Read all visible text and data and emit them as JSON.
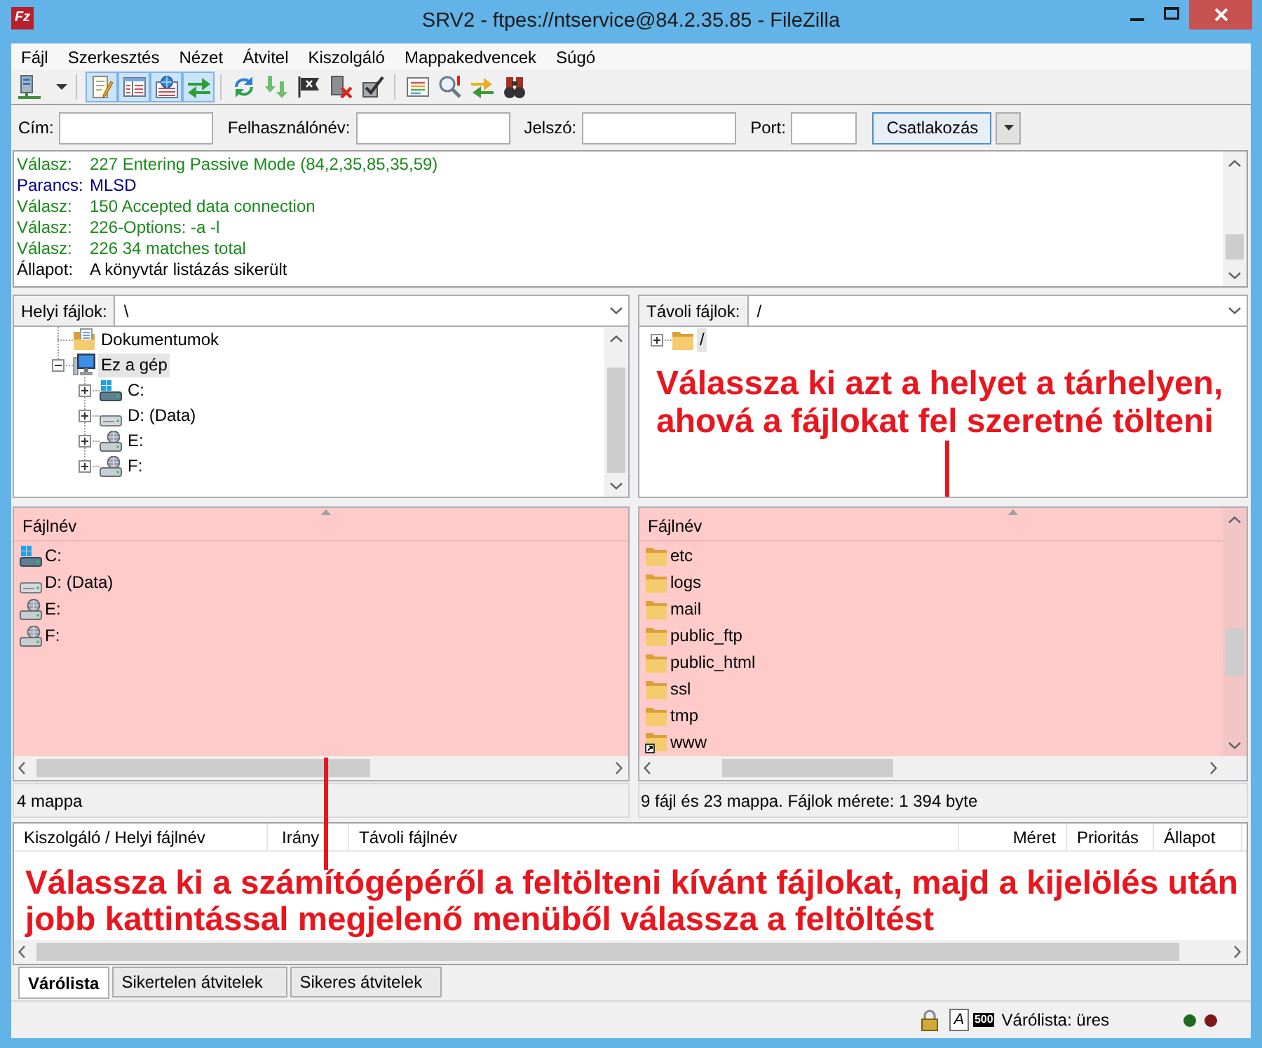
{
  "window": {
    "app_icon": "Fz",
    "title": "SRV2 - ftpes://ntservice@84.2.35.85 - FileZilla"
  },
  "menu": [
    "Fájl",
    "Szerkesztés",
    "Nézet",
    "Átvitel",
    "Kiszolgáló",
    "Mappakedvencek",
    "Súgó"
  ],
  "toolbar": [
    {
      "items": [
        {
          "kind": "site-manager"
        }
      ]
    },
    {
      "items": [
        {
          "kind": "message-log",
          "on": true
        },
        {
          "kind": "local-tree",
          "on": true
        },
        {
          "kind": "remote-tree",
          "on": true
        },
        {
          "kind": "transfer-queue",
          "on": true
        }
      ]
    },
    {
      "items": [
        {
          "kind": "refresh"
        },
        {
          "kind": "process-queue"
        },
        {
          "kind": "cancel"
        },
        {
          "kind": "disconnect"
        },
        {
          "kind": "reconnect"
        }
      ]
    },
    {
      "items": [
        {
          "kind": "filter"
        },
        {
          "kind": "compare"
        },
        {
          "kind": "sync-browse"
        },
        {
          "kind": "search"
        }
      ]
    }
  ],
  "quickconnect": {
    "fields": [
      {
        "kind": "text",
        "label": "Cím:"
      },
      {
        "kind": "text",
        "label": "Felhasználónév:"
      },
      {
        "kind": "text",
        "label": "Jelszó:"
      },
      {
        "kind": "port",
        "label": "Port:"
      }
    ],
    "button": "Csatlakozás"
  },
  "message_log": [
    {
      "kind": "response",
      "label": "Válasz:",
      "text": "227 Entering Passive Mode (84,2,35,85,35,59)"
    },
    {
      "kind": "command",
      "label": "Parancs:",
      "text": "MLSD"
    },
    {
      "kind": "response",
      "label": "Válasz:",
      "text": "150 Accepted data connection"
    },
    {
      "kind": "response",
      "label": "Válasz:",
      "text": "226-Options: -a -l"
    },
    {
      "kind": "response",
      "label": "Válasz:",
      "text": "226 34 matches total"
    },
    {
      "kind": "status",
      "label": "Állapot:",
      "text": "A könyvtár listázás sikerült"
    }
  ],
  "local": {
    "path_label": "Helyi fájlok:",
    "path": "\\",
    "tree": [
      {
        "kind": "documents",
        "label": "Dokumentumok",
        "selected": false
      },
      {
        "kind": "computer",
        "label": "Ez a gép",
        "selected": true,
        "expanded": true,
        "children": [
          {
            "kind": "system-drive",
            "label": "C:",
            "selected": false,
            "expanded": false
          },
          {
            "kind": "drive",
            "label": "D: (Data)",
            "selected": false,
            "expanded": false
          },
          {
            "kind": "network-drive",
            "label": "E:",
            "selected": false,
            "expanded": false
          },
          {
            "kind": "network-drive",
            "label": "F:",
            "selected": false,
            "expanded": false
          }
        ]
      }
    ],
    "list": {
      "highlighted": true,
      "column": "Fájlnév",
      "items": [
        {
          "kind": "system-drive",
          "name": "C:"
        },
        {
          "kind": "drive",
          "name": "D: (Data)"
        },
        {
          "kind": "network-drive",
          "name": "E:"
        },
        {
          "kind": "network-drive",
          "name": "F:"
        }
      ],
      "status": "4 mappa"
    }
  },
  "remote": {
    "path_label": "Távoli fájlok:",
    "path": "/",
    "tree": [
      {
        "kind": "folder",
        "label": "/",
        "selected": true,
        "expanded": false
      }
    ],
    "annotation": {
      "lines": [
        "Válassza ki azt a helyet a tárhelyen,",
        "ahová a fájlokat fel szeretné tölteni"
      ]
    },
    "list": {
      "highlighted": true,
      "column": "Fájlnév",
      "items": [
        {
          "kind": "folder",
          "name": "etc"
        },
        {
          "kind": "folder",
          "name": "logs"
        },
        {
          "kind": "folder",
          "name": "mail"
        },
        {
          "kind": "folder",
          "name": "public_ftp"
        },
        {
          "kind": "folder",
          "name": "public_html"
        },
        {
          "kind": "folder",
          "name": "ssl"
        },
        {
          "kind": "folder",
          "name": "tmp"
        },
        {
          "kind": "link",
          "name": "www"
        }
      ],
      "status": "9 fájl és 23 mappa. Fájlok mérete: 1 394 byte"
    }
  },
  "queue": {
    "columns": [
      "Kiszolgáló / Helyi fájlnév",
      "Irány",
      "Távoli fájlnév",
      "Méret",
      "Prioritás",
      "Állapot"
    ],
    "annotation": {
      "lines": [
        "Válassza ki a számítógépéről a feltölteni kívánt fájlokat, majd a kijelölés után",
        "jobb kattintással megjelenő menüből válassza a feltöltést"
      ]
    },
    "tabs": [
      {
        "label": "Várólista",
        "selected": true
      },
      {
        "label": "Sikertelen átvitelek",
        "selected": false
      },
      {
        "label": "Sikeres átvitelek",
        "selected": false
      }
    ]
  },
  "status_bar": {
    "transfer_type": "A",
    "speed_limit": "500",
    "queue_status": "Várólista: üres",
    "lights": [
      {
        "color": "#1e6b1e"
      },
      {
        "color": "#7d1a1a"
      }
    ]
  }
}
